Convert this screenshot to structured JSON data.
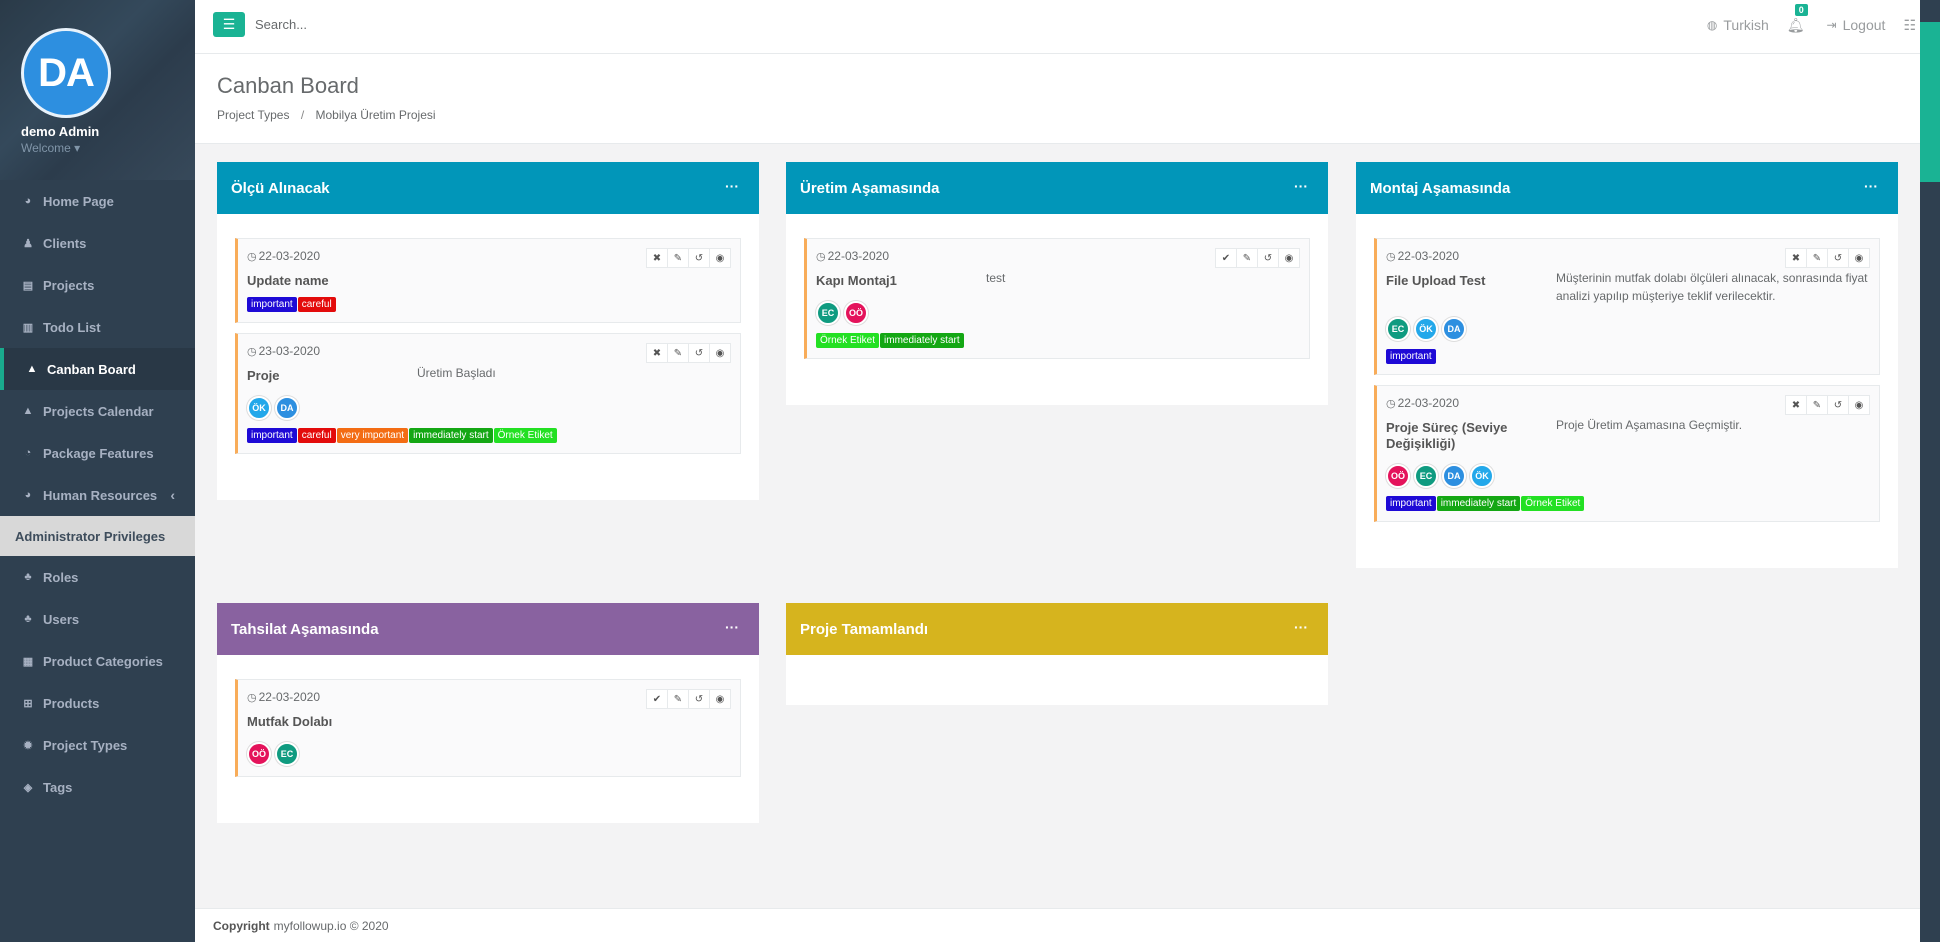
{
  "profile": {
    "initials": "DA",
    "name": "demo Admin",
    "welcome": "Welcome ▾"
  },
  "sidebar": {
    "items": [
      {
        "label": "Home Page",
        "icon": "dashboard-icon",
        "glyph": "◕"
      },
      {
        "label": "Clients",
        "icon": "user-icon",
        "glyph": "♟"
      },
      {
        "label": "Projects",
        "icon": "project-icon",
        "glyph": "▤"
      },
      {
        "label": "Todo List",
        "icon": "book-icon",
        "glyph": "▥"
      },
      {
        "label": "Canban Board",
        "icon": "road-icon",
        "glyph": "▲",
        "active": true
      },
      {
        "label": "Projects Calendar",
        "icon": "road-icon",
        "glyph": "▲"
      },
      {
        "label": "Package Features",
        "icon": "pie-chart-icon",
        "glyph": "◔"
      },
      {
        "label": "Human Resources",
        "icon": "dashboard-icon",
        "glyph": "◕",
        "caret": "‹"
      }
    ],
    "section_title": "Administrator Privileges",
    "admin_items": [
      {
        "label": "Roles",
        "icon": "users-icon",
        "glyph": "♣"
      },
      {
        "label": "Users",
        "icon": "users-icon",
        "glyph": "♣"
      },
      {
        "label": "Product Categories",
        "icon": "table-icon",
        "glyph": "▦"
      },
      {
        "label": "Products",
        "icon": "cart-icon",
        "glyph": "⊞"
      },
      {
        "label": "Project Types",
        "icon": "gear-icon",
        "glyph": "✹"
      },
      {
        "label": "Tags",
        "icon": "tags-icon",
        "glyph": "◈"
      }
    ]
  },
  "topbar": {
    "menu_icon": "☰",
    "search_placeholder": "Search...",
    "language": "Turkish",
    "notification_count": "0",
    "logout": "Logout"
  },
  "page": {
    "title": "Canban Board",
    "breadcrumb": [
      "Project Types",
      "/",
      "Mobilya Üretim Projesi"
    ]
  },
  "columns": [
    {
      "title": "Ölçü Alınacak",
      "color": "#0196b9",
      "cards": [
        {
          "date": "22-03-2020",
          "title": "Update name",
          "desc": "",
          "first_action": "✖",
          "avatars": [],
          "tags": [
            {
              "label": "important",
              "color": "#1e0ad6"
            },
            {
              "label": "careful",
              "color": "#e30b0b"
            }
          ]
        },
        {
          "date": "23-03-2020",
          "title": "Proje",
          "desc": "Üretim Başladı",
          "first_action": "✖",
          "avatars": [
            {
              "text": "ÖK",
              "color": "#23a8ea"
            },
            {
              "text": "DA",
              "color": "#2d8fe0"
            }
          ],
          "tags": [
            {
              "label": "important",
              "color": "#1e0ad6"
            },
            {
              "label": "careful",
              "color": "#e30b0b"
            },
            {
              "label": "very important",
              "color": "#f36c13"
            },
            {
              "label": "immediately start",
              "color": "#14a714"
            },
            {
              "label": "Örnek Etiket",
              "color": "#23e023"
            }
          ]
        }
      ]
    },
    {
      "title": "Üretim Aşamasında",
      "color": "#0196b9",
      "cards": [
        {
          "date": "22-03-2020",
          "title": "Kapı Montaj1",
          "desc": "test",
          "first_action": "✔",
          "avatars": [
            {
              "text": "EC",
              "color": "#0f9b80"
            },
            {
              "text": "OÖ",
              "color": "#e4135b"
            }
          ],
          "tags": [
            {
              "label": "Örnek Etiket",
              "color": "#23e023"
            },
            {
              "label": "immediately start",
              "color": "#14a714"
            }
          ]
        }
      ]
    },
    {
      "title": "Montaj Aşamasında",
      "color": "#0196b9",
      "cards": [
        {
          "date": "22-03-2020",
          "title": "File Upload Test",
          "desc": "Müşterinin mutfak dolabı ölçüleri alınacak, sonrasında fiyat analizi yapılıp müşteriye teklif verilecektir.",
          "first_action": "✖",
          "avatars": [
            {
              "text": "EC",
              "color": "#0f9b80"
            },
            {
              "text": "ÖK",
              "color": "#23a8ea"
            },
            {
              "text": "DA",
              "color": "#2d8fe0"
            }
          ],
          "tags": [
            {
              "label": "important",
              "color": "#1e0ad6"
            }
          ]
        },
        {
          "date": "22-03-2020",
          "title": "Proje Süreç (Seviye Değişikliği)",
          "desc": "Proje Üretim Aşamasına Geçmiştir.",
          "first_action": "✖",
          "avatars": [
            {
              "text": "OÖ",
              "color": "#e4135b"
            },
            {
              "text": "EC",
              "color": "#0f9b80"
            },
            {
              "text": "DA",
              "color": "#2d8fe0"
            },
            {
              "text": "ÖK",
              "color": "#23a8ea"
            }
          ],
          "tags": [
            {
              "label": "important",
              "color": "#1e0ad6"
            },
            {
              "label": "immediately start",
              "color": "#14a714"
            },
            {
              "label": "Örnek Etiket",
              "color": "#23e023"
            }
          ]
        }
      ]
    },
    {
      "title": "Tahsilat Aşamasında",
      "color": "#8962a0",
      "cards": [
        {
          "date": "22-03-2020",
          "title": "Mutfak Dolabı",
          "desc": "",
          "first_action": "✔",
          "avatars": [
            {
              "text": "OÖ",
              "color": "#e4135b"
            },
            {
              "text": "EC",
              "color": "#0f9b80"
            }
          ],
          "tags": []
        }
      ]
    },
    {
      "title": "Proje Tamamlandı",
      "color": "#d6b41e",
      "cards": []
    }
  ],
  "column_menu": "···",
  "card_actions": [
    "✎",
    "↺",
    "◉"
  ],
  "footer": {
    "copyright_label": "Copyright",
    "text": "myfollowup.io © 2020"
  }
}
